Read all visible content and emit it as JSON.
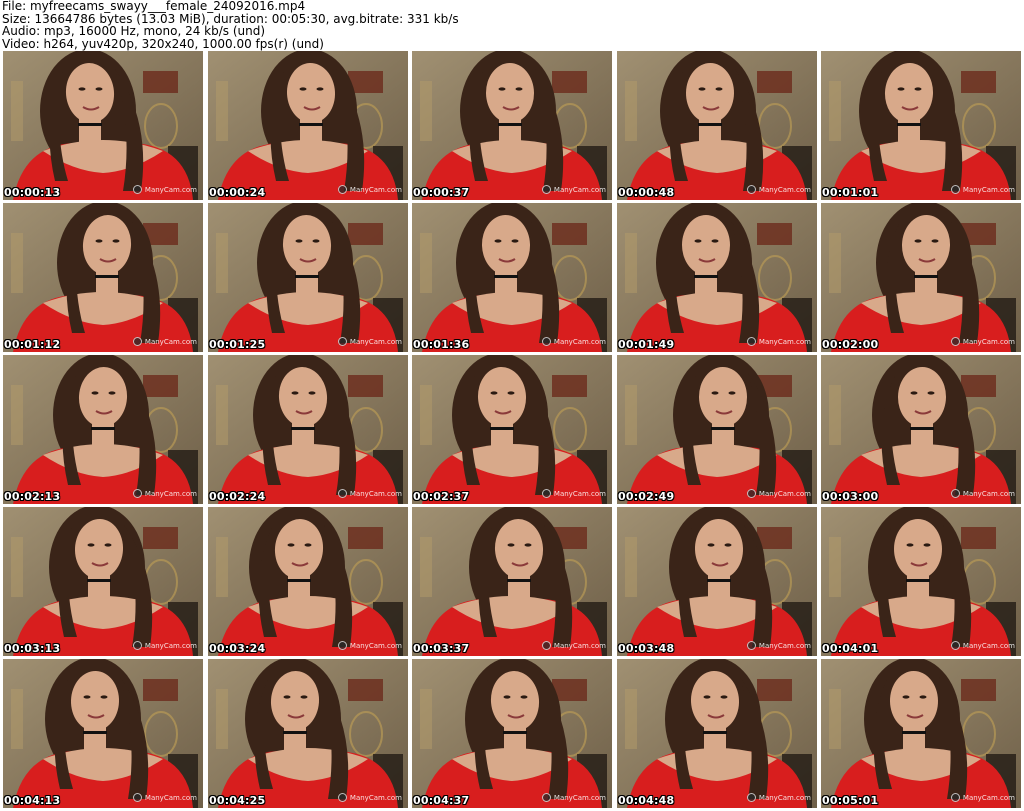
{
  "header": {
    "file_line": "File: myfreecams_swayy___female_24092016.mp4",
    "size_line": "Size: 13664786 bytes (13.03 MiB), duration: 00:05:30, avg.bitrate: 331 kb/s",
    "audio_line": "Audio: mp3, 16000 Hz, mono, 24 kb/s (und)",
    "video_line": "Video: h264, yuv420p, 320x240, 1000.00 fps(r) (und)"
  },
  "watermark_text": "ManyCam.com",
  "frames": [
    {
      "timestamp": "00:00:13"
    },
    {
      "timestamp": "00:00:24"
    },
    {
      "timestamp": "00:00:37"
    },
    {
      "timestamp": "00:00:48"
    },
    {
      "timestamp": "00:01:01"
    },
    {
      "timestamp": "00:01:12"
    },
    {
      "timestamp": "00:01:25"
    },
    {
      "timestamp": "00:01:36"
    },
    {
      "timestamp": "00:01:49"
    },
    {
      "timestamp": "00:02:00"
    },
    {
      "timestamp": "00:02:13"
    },
    {
      "timestamp": "00:02:24"
    },
    {
      "timestamp": "00:02:37"
    },
    {
      "timestamp": "00:02:49"
    },
    {
      "timestamp": "00:03:00"
    },
    {
      "timestamp": "00:03:13"
    },
    {
      "timestamp": "00:03:24"
    },
    {
      "timestamp": "00:03:37"
    },
    {
      "timestamp": "00:03:48"
    },
    {
      "timestamp": "00:04:01"
    },
    {
      "timestamp": "00:04:13"
    },
    {
      "timestamp": "00:04:25"
    },
    {
      "timestamp": "00:04:37"
    },
    {
      "timestamp": "00:04:48"
    },
    {
      "timestamp": "00:05:01"
    }
  ],
  "colors": {
    "page_background": "#ffffff",
    "wall": "#8a7a5e",
    "dress_red": "#d81e1e",
    "skin": "#d8a98a",
    "hair": "#3a2418",
    "timestamp_text": "#ffffff"
  }
}
